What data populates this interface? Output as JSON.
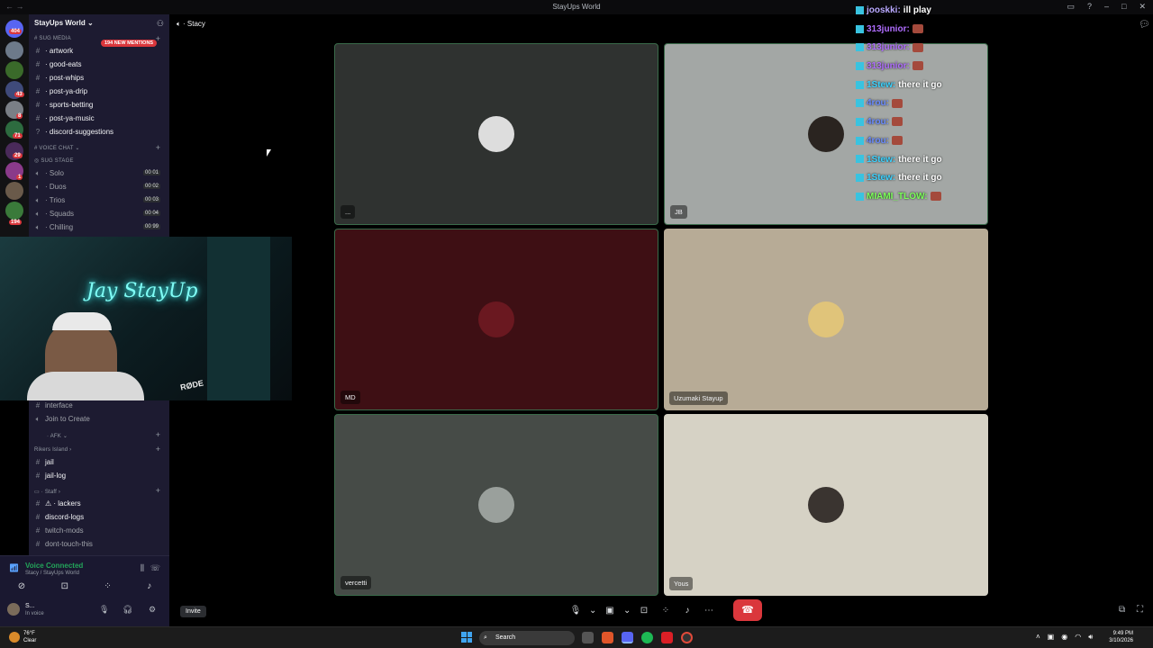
{
  "window": {
    "title": "StayUps World"
  },
  "server": {
    "name": "StayUps World",
    "mentions_badge": "194 NEW MENTIONS",
    "rail_badges": [
      "404",
      "43",
      "8",
      "71",
      "29",
      "1",
      "194"
    ]
  },
  "sidebar": {
    "category_media": "SUG MEDIA",
    "media_channels": [
      "artwork",
      "good-eats",
      "post-whips",
      "post-ya-drip",
      "sports-betting",
      "post-ya-music",
      "discord-suggestions"
    ],
    "category_voice": "VOICE CHAT",
    "stage": "SUG STAGE",
    "voice_channels": [
      {
        "name": "Solo",
        "count": "00 01"
      },
      {
        "name": "Duos",
        "count": "00 02"
      },
      {
        "name": "Trios",
        "count": "00 03"
      },
      {
        "name": "Squads",
        "count": "00 04"
      },
      {
        "name": "Chilling",
        "count": "00 99"
      }
    ],
    "lower_items": {
      "interface": "interface",
      "join_to_create": "Join to Create",
      "afk": "AFK",
      "rikers": "Rikers Island",
      "jail": "jail",
      "jail_log": "jail-log",
      "staff": "Staff",
      "lackers": "lackers",
      "discord_logs": "discord-logs",
      "twitch_mods": "twitch-mods",
      "dont_touch": "dont-touch-this"
    },
    "voice_status": {
      "title": "Voice Connected",
      "subtitle": "Stacy / StayUps World"
    },
    "user": {
      "name": "S...",
      "status": "In voice"
    }
  },
  "webcam": {
    "neon_sign": "Jay StayUp",
    "mic_brand": "RØDE"
  },
  "voice_channel": {
    "name": "Stacy",
    "invite_label": "Invite"
  },
  "participants": [
    {
      "name": "...",
      "bg": "#2f3230"
    },
    {
      "name": "JB",
      "bg": "#a3a7a5"
    },
    {
      "name": "MD",
      "bg": "#3e0f14"
    },
    {
      "name": "Uzumaki Stayup",
      "bg": "#b7ab96"
    },
    {
      "name": "vercetti",
      "bg": "#464b47"
    },
    {
      "name": "Yous",
      "bg": "#d6d2c5"
    }
  ],
  "chat": [
    {
      "user": "jooskki:",
      "text": "ill play",
      "color": "#b9a8ff",
      "emote": false
    },
    {
      "user": "313junior:",
      "text": "",
      "color": "#b06dff",
      "emote": true
    },
    {
      "user": "313junior:",
      "text": "",
      "color": "#b06dff",
      "emote": true
    },
    {
      "user": "313junior:",
      "text": "",
      "color": "#b06dff",
      "emote": true
    },
    {
      "user": "1Stew:",
      "text": "there it go",
      "color": "#39d2ff",
      "emote": false
    },
    {
      "user": "4rou:",
      "text": "",
      "color": "#6a8bff",
      "emote": true
    },
    {
      "user": "4rou:",
      "text": "",
      "color": "#6a8bff",
      "emote": true
    },
    {
      "user": "4rou:",
      "text": "",
      "color": "#6a8bff",
      "emote": true
    },
    {
      "user": "1Stew:",
      "text": "there it go",
      "color": "#39d2ff",
      "emote": false
    },
    {
      "user": "1Stew:",
      "text": "there it go",
      "color": "#39d2ff",
      "emote": false
    },
    {
      "user": "MIAMI_TLOW:",
      "text": "",
      "color": "#7cff5a",
      "emote": true
    }
  ],
  "taskbar": {
    "weather_temp": "76°F",
    "weather_desc": "Clear",
    "search_placeholder": "Search",
    "time": "9:49 PM",
    "date": "3/10/2026"
  }
}
